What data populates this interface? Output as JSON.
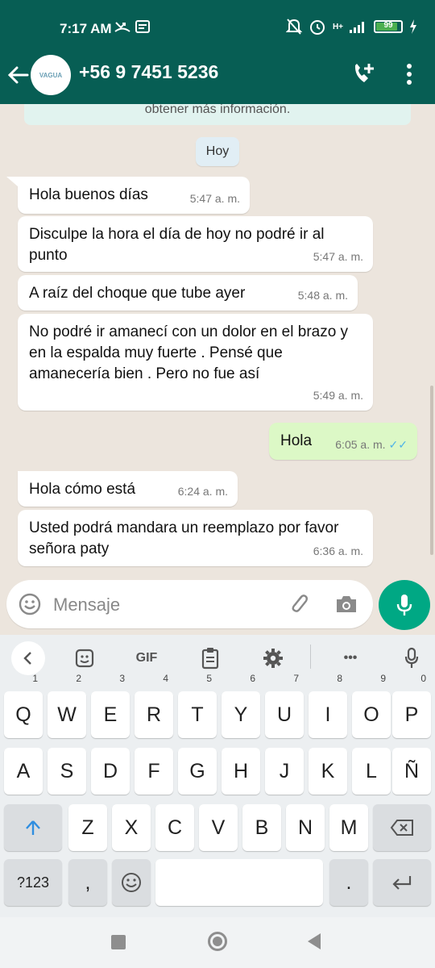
{
  "status_bar": {
    "time": "7:17 AM",
    "battery": "99",
    "network": "H+"
  },
  "header": {
    "contact": "+56 9 7451 5236",
    "avatar_text": "VAGUA"
  },
  "chat": {
    "banner": "obtener más información.",
    "day_label": "Hoy",
    "messages": [
      {
        "dir": "in",
        "text": "Hola buenos días",
        "time": "5:47 a. m."
      },
      {
        "dir": "in",
        "text": "Disculpe la hora el día de hoy no podré ir al punto",
        "time": "5:47 a. m."
      },
      {
        "dir": "in",
        "text": "A raíz del choque que tube ayer",
        "time": "5:48 a. m."
      },
      {
        "dir": "in",
        "text": "No podré ir amanecí con un dolor en el brazo y en la espalda muy fuerte . Pensé que amanecería bien . Pero no fue así",
        "time": "5:49 a. m."
      },
      {
        "dir": "out",
        "text": "Hola",
        "time": "6:05 a. m.",
        "ticks": "✓✓"
      },
      {
        "dir": "in",
        "text": "Hola cómo está",
        "time": "6:24 a. m."
      },
      {
        "dir": "in",
        "text": "Usted podrá mandara un reemplazo por favor señora paty",
        "time": "6:36 a. m."
      }
    ]
  },
  "composer": {
    "placeholder": "Mensaje"
  },
  "keyboard": {
    "toolbar": {
      "gif_label": "GIF",
      "more_label": "•••"
    },
    "row1": [
      {
        "k": "Q",
        "h": "1"
      },
      {
        "k": "W",
        "h": "2"
      },
      {
        "k": "E",
        "h": "3"
      },
      {
        "k": "R",
        "h": "4"
      },
      {
        "k": "T",
        "h": "5"
      },
      {
        "k": "Y",
        "h": "6"
      },
      {
        "k": "U",
        "h": "7"
      },
      {
        "k": "I",
        "h": "8"
      },
      {
        "k": "O",
        "h": "9"
      },
      {
        "k": "P",
        "h": "0"
      }
    ],
    "row2": [
      "A",
      "S",
      "D",
      "F",
      "G",
      "H",
      "J",
      "K",
      "L",
      "Ñ"
    ],
    "row3": [
      "Z",
      "X",
      "C",
      "V",
      "B",
      "N",
      "M"
    ],
    "symbols_label": "?123",
    "comma_label": ",",
    "period_label": "."
  },
  "colors": {
    "header": "#075e54",
    "accent": "#00a884",
    "out_bubble": "#dcf8c6",
    "tick": "#4fb3e8"
  }
}
